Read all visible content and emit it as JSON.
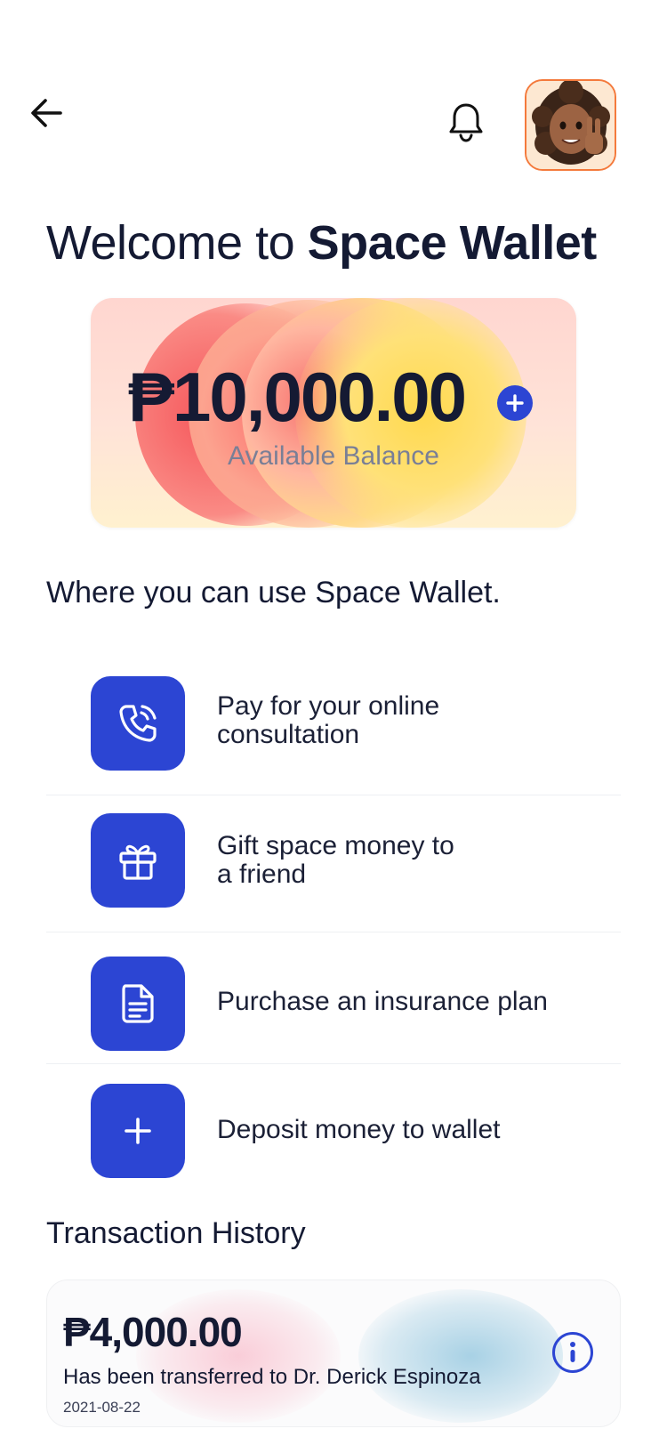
{
  "header": {
    "back_icon": "arrow-left-icon",
    "notification_icon": "bell-icon",
    "avatar_icon": "memoji-avatar"
  },
  "welcome": {
    "prefix": "Welcome to ",
    "brand": "Space Wallet"
  },
  "balance": {
    "amount": "₱10,000.00",
    "label": "Available Balance",
    "add_icon": "plus-icon"
  },
  "uses": {
    "title": "Where you can use Space Wallet.",
    "items": [
      {
        "icon": "phone-call-icon",
        "label": "Pay for your online\nconsultation"
      },
      {
        "icon": "gift-icon",
        "label": "Gift space money to\na friend"
      },
      {
        "icon": "document-icon",
        "label": "Purchase an insurance plan"
      },
      {
        "icon": "plus-icon",
        "label": "Deposit money to wallet"
      }
    ]
  },
  "transactions": {
    "title": "Transaction History",
    "items": [
      {
        "amount": "₱4,000.00",
        "description": "Has been transferred to Dr. Derick Espinoza",
        "date": "2021-08-22",
        "info_icon": "info-icon"
      }
    ]
  },
  "colors": {
    "primary": "#2c45d3",
    "text": "#141a33",
    "muted": "#7a7f96",
    "avatar_border": "#f47a3c"
  }
}
